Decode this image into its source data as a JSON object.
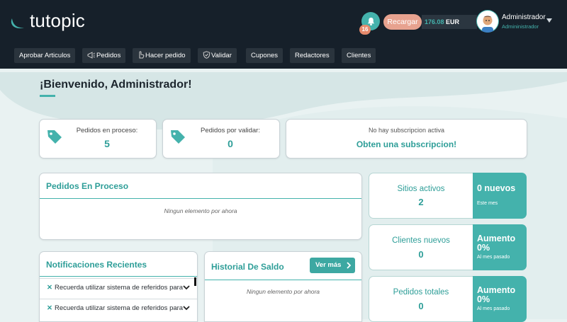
{
  "header": {
    "logo_text": "tutopic",
    "notifications_count": "16",
    "recharge_label": "Recargar",
    "balance_amount": "176.08",
    "balance_currency": "EUR",
    "user_name": "Administrador",
    "user_role": "Admininistrador"
  },
  "nav": {
    "items": [
      {
        "label": "Aprobar Articulos"
      },
      {
        "label": "Pedidos"
      },
      {
        "label": "Hacer pedido"
      },
      {
        "label": "Validar"
      },
      {
        "label": "Cupones"
      },
      {
        "label": "Redactores"
      },
      {
        "label": "Clientes"
      }
    ]
  },
  "welcome": "¡Bienvenido, Administrador!",
  "stats": {
    "in_process_title": "Pedidos en proceso:",
    "in_process_value": "5",
    "to_validate_title": "Pedidos por validar:",
    "to_validate_value": "0",
    "subscription_text": "No hay subscripcion activa",
    "subscription_link": "Obten una subscripcion!"
  },
  "orders_in_process": {
    "title": "Pedidos En Proceso",
    "empty_text": "Ningun elemento por ahora"
  },
  "notifications": {
    "title": "Notificaciones Recientes",
    "items": [
      {
        "text": "Recuerda utilizar sistema de referidos para"
      },
      {
        "text": "Recuerda utilizar sistema de referidos para"
      }
    ]
  },
  "balance_history": {
    "title": "Historial De Saldo",
    "button_label": "Ver más",
    "empty_text": "Ningun elemento por ahora"
  },
  "right_cards": [
    {
      "title": "Sitios activos",
      "value": "2",
      "big": "0 nuevos",
      "small": "Este mes"
    },
    {
      "title": "Clientes nuevos",
      "value": "0",
      "big": "Aumento 0%",
      "small": "Al mes pasado"
    },
    {
      "title": "Pedidos totales",
      "value": "0",
      "big": "Aumento 0%",
      "small": "Al mes pasado"
    }
  ],
  "colors": {
    "accent": "#44b2ac",
    "header": "#16202a",
    "recharge": "#e7a28f"
  }
}
